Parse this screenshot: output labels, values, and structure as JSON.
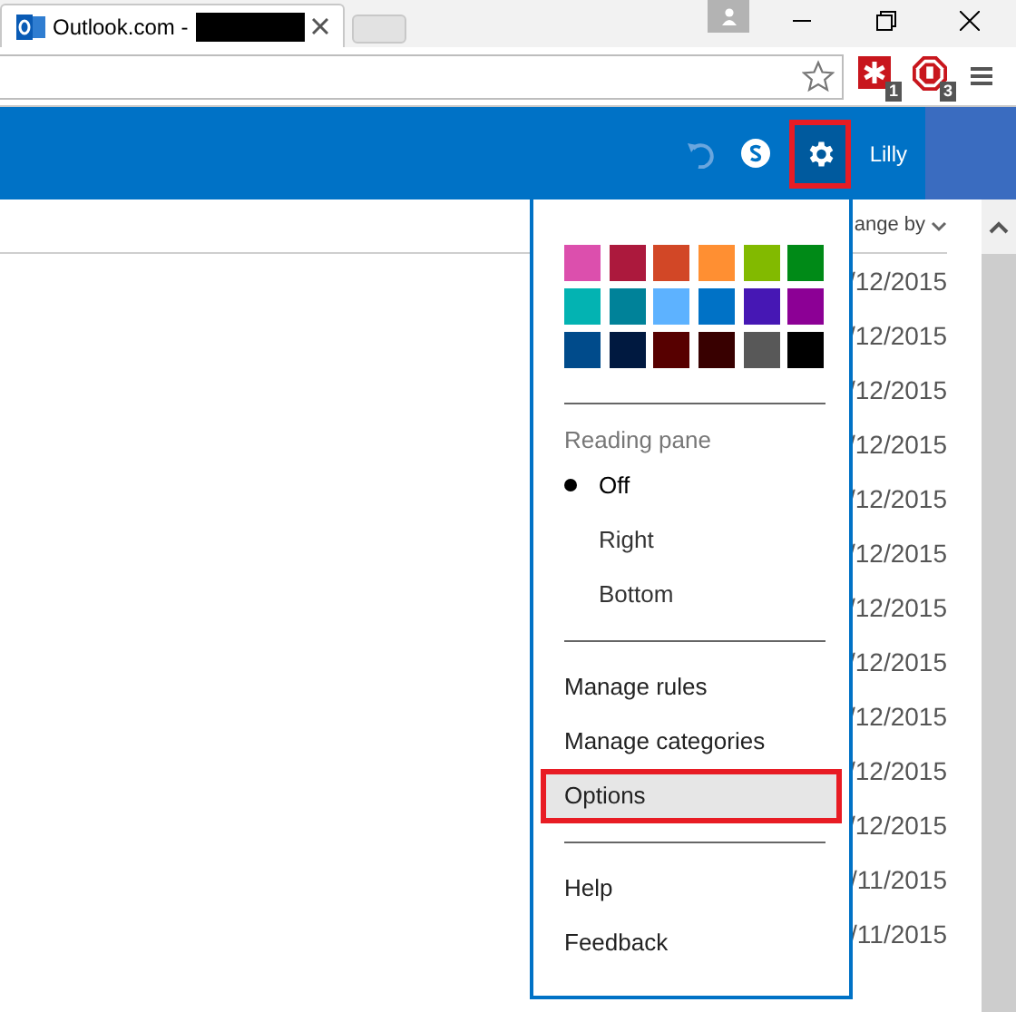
{
  "browser": {
    "tab": {
      "title": "Outlook.com -"
    },
    "extensions": [
      {
        "badge": "1"
      },
      {
        "badge": "3"
      }
    ]
  },
  "header": {
    "user": "Lilly",
    "settings_highlighted": true
  },
  "list": {
    "sort_label": "ange by",
    "dates": [
      "/12/2015",
      "/12/2015",
      "/12/2015",
      "/12/2015",
      "/12/2015",
      "/12/2015",
      "/12/2015",
      "/12/2015",
      "/12/2015",
      "/12/2015",
      "/12/2015",
      "/11/2015",
      "/11/2015"
    ]
  },
  "settings_menu": {
    "themes": [
      {
        "color": "#dc4fad"
      },
      {
        "color": "#ac193d"
      },
      {
        "color": "#d24726"
      },
      {
        "color": "#ff8f32"
      },
      {
        "color": "#82ba00"
      },
      {
        "color": "#008a17"
      },
      {
        "color": "#03b3b2"
      },
      {
        "color": "#008299"
      },
      {
        "color": "#5db2ff"
      },
      {
        "color": "#0072c6"
      },
      {
        "color": "#4617b4"
      },
      {
        "color": "#8c0095"
      },
      {
        "color": "#004b8b"
      },
      {
        "color": "#001940"
      },
      {
        "color": "#570000"
      },
      {
        "color": "#380000"
      },
      {
        "color": "#585858"
      },
      {
        "color": "#000000"
      }
    ],
    "reading_pane": {
      "title": "Reading pane",
      "options": [
        {
          "label": "Off",
          "selected": true
        },
        {
          "label": "Right",
          "selected": false
        },
        {
          "label": "Bottom",
          "selected": false
        }
      ]
    },
    "groups": [
      [
        {
          "label": "Manage rules",
          "highlighted": false
        },
        {
          "label": "Manage categories",
          "highlighted": false
        },
        {
          "label": "Options",
          "highlighted": true
        }
      ],
      [
        {
          "label": "Help",
          "highlighted": false
        },
        {
          "label": "Feedback",
          "highlighted": false
        }
      ]
    ]
  }
}
